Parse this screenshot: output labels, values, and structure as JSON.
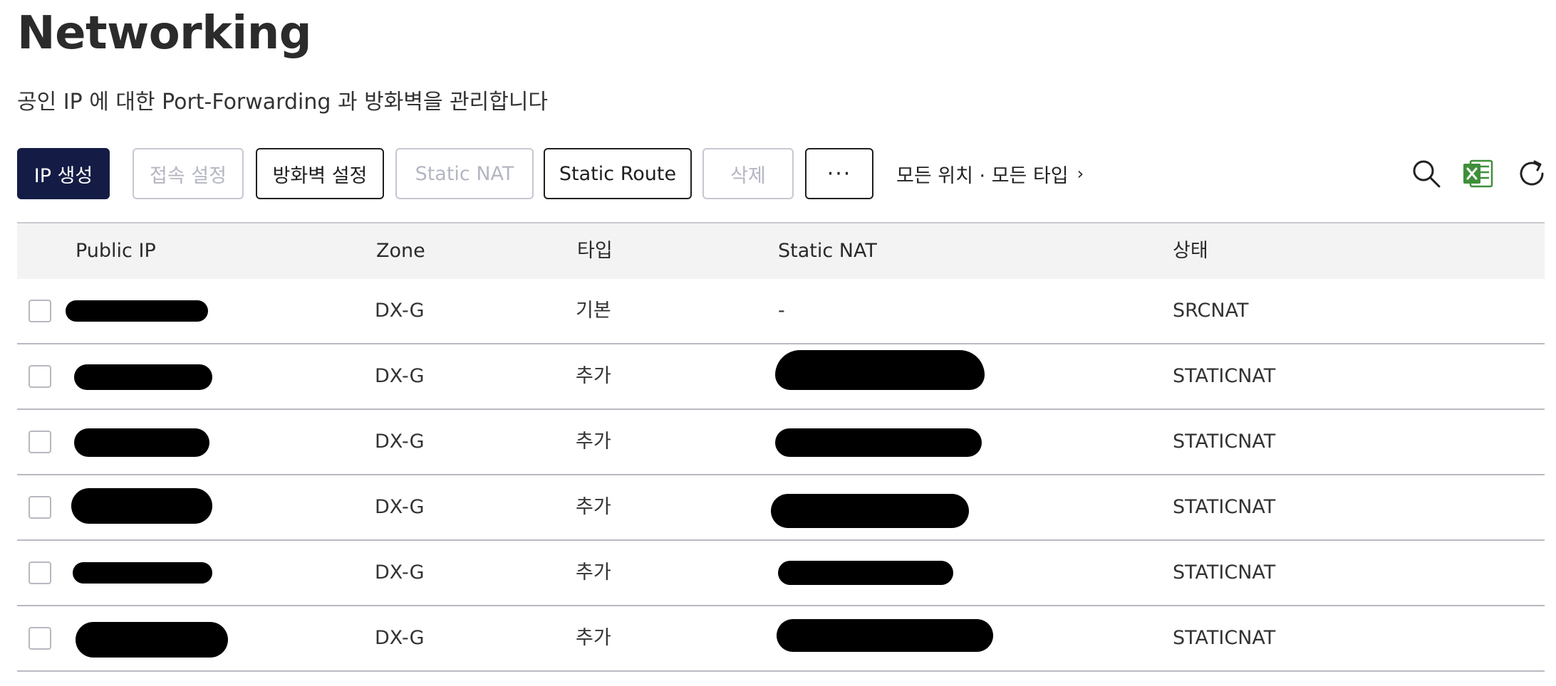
{
  "page": {
    "title": "Networking",
    "subtitle": "공인 IP 에 대한 Port-Forwarding 과 방화벽을 관리합니다"
  },
  "toolbar": {
    "create_ip": "IP 생성",
    "access_settings": "접속 설정",
    "firewall_settings": "방화벽 설정",
    "static_nat": "Static NAT",
    "static_route": "Static Route",
    "delete": "삭제",
    "more": "···",
    "filter": "모든 위치 · 모든 타입",
    "filter_chevron": "›"
  },
  "icons": {
    "search": "search-icon",
    "excel": "excel-icon",
    "refresh": "refresh-icon",
    "excel_color": "#3f8f3a"
  },
  "table": {
    "headers": {
      "public_ip": "Public IP",
      "zone": "Zone",
      "type": "타입",
      "static_nat": "Static NAT",
      "status": "상태"
    },
    "rows": [
      {
        "zone": "DX-G",
        "type": "기본",
        "static_nat": "-",
        "status": "SRCNAT"
      },
      {
        "zone": "DX-G",
        "type": "추가",
        "static_nat": "",
        "status": "STATICNAT"
      },
      {
        "zone": "DX-G",
        "type": "추가",
        "static_nat": "",
        "status": "STATICNAT"
      },
      {
        "zone": "DX-G",
        "type": "추가",
        "static_nat": "",
        "status": "STATICNAT"
      },
      {
        "zone": "DX-G",
        "type": "추가",
        "static_nat": "",
        "status": "STATICNAT"
      },
      {
        "zone": "DX-G",
        "type": "추가",
        "static_nat": "",
        "status": "STATICNAT"
      }
    ]
  },
  "colors": {
    "primary": "#141c45",
    "disabled_border": "#c6c8d2",
    "disabled_text": "#b4b6c2",
    "header_bg": "#f3f3f3"
  }
}
